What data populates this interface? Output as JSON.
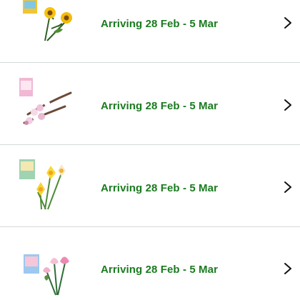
{
  "orders": [
    {
      "product_icon": "sunflowers-lego-set-icon",
      "delivery_text": "Arriving 28 Feb - 5 Mar",
      "chevron_icon": "chevron-right-icon"
    },
    {
      "product_icon": "cherry-blossoms-lego-set-icon",
      "delivery_text": "Arriving 28 Feb - 5 Mar",
      "chevron_icon": "chevron-right-icon"
    },
    {
      "product_icon": "daffodils-lego-set-icon",
      "delivery_text": "Arriving 28 Feb - 5 Mar",
      "chevron_icon": "chevron-right-icon"
    },
    {
      "product_icon": "lotus-flowers-lego-set-icon",
      "delivery_text": "Arriving 28 Feb - 5 Mar",
      "chevron_icon": "chevron-right-icon"
    }
  ],
  "colors": {
    "delivery_green": "#1a7b1f",
    "divider": "#d5d9d9",
    "chevron": "#111111"
  }
}
